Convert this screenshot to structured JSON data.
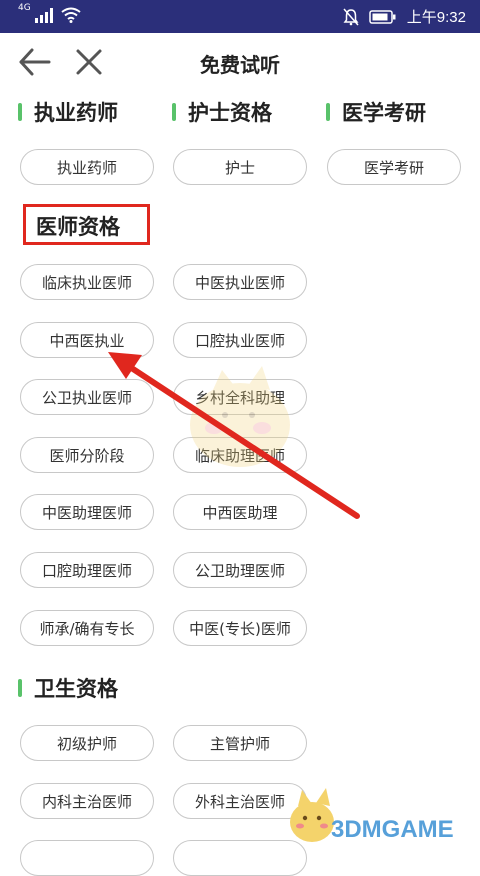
{
  "status_bar": {
    "network": "4G",
    "time": "上午9:32",
    "icons": [
      "signal-icon",
      "wifi-icon",
      "mute-icon",
      "battery-icon"
    ]
  },
  "nav": {
    "title": "免费试听",
    "icons": [
      "back-arrow-icon",
      "close-icon"
    ]
  },
  "categories_top": [
    {
      "title": "执业药师",
      "items": [
        "执业药师"
      ]
    },
    {
      "title": "护士资格",
      "items": [
        "护士"
      ]
    },
    {
      "title": "医学考研",
      "items": [
        "医学考研"
      ]
    }
  ],
  "physician": {
    "title": "医师资格",
    "items": [
      "临床执业医师",
      "中医执业医师",
      "中西医执业",
      "口腔执业医师",
      "公卫执业医师",
      "乡村全科助理",
      "医师分阶段",
      "临床助理医师",
      "中医助理医师",
      "中西医助理",
      "口腔助理医师",
      "公卫助理医师",
      "师承/确有专长",
      "中医(专长)医师"
    ]
  },
  "health": {
    "title": "卫生资格",
    "items": [
      "初级护师",
      "主管护师",
      "内科主治医师",
      "外科主治医师"
    ]
  },
  "watermark": "3DMGAME",
  "colors": {
    "status_bar": "#2b2f7a",
    "accent_green": "#59c26a",
    "highlight_red": "#e0271e",
    "watermark_blue": "#4f9bd8"
  }
}
